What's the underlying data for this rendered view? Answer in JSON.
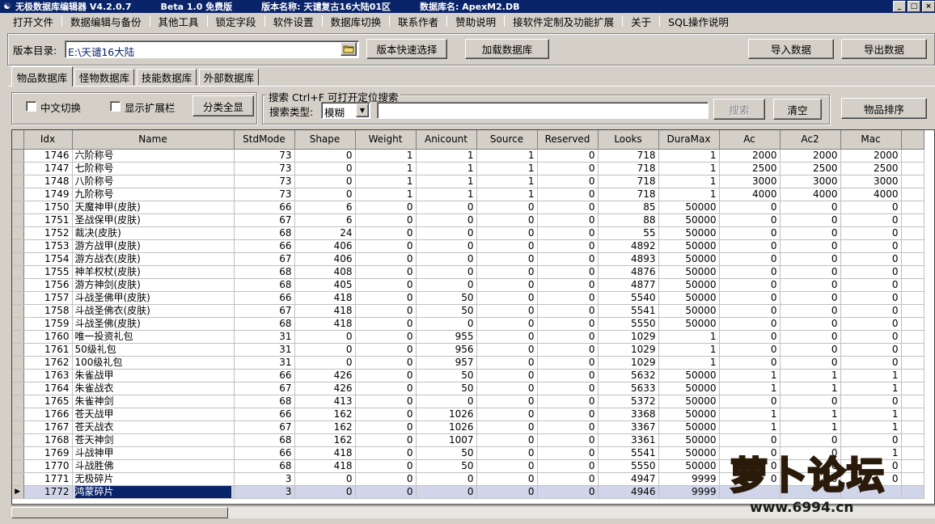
{
  "window": {
    "title_parts": [
      "无极数据库编辑器 V4.2.0.7",
      "Beta 1.0 免费版",
      "版本名称: 天谴复古16大陆01区",
      "数据库名: ApexM2.DB"
    ],
    "buttons": [
      "_",
      "□",
      "×"
    ]
  },
  "menu": {
    "items": [
      "打开文件",
      "数据编辑与备份",
      "其他工具",
      "锁定字段",
      "软件设置",
      "数据库切换",
      "联系作者",
      "赞助说明",
      "接软件定制及功能扩展",
      "关于",
      "SQL操作说明"
    ]
  },
  "toolbar": {
    "version_dir_label": "版本目录:",
    "version_dir_value": "E:\\天谴16大陆",
    "quick_select_label": "版本快速选择",
    "load_db_label": "加载数据库",
    "import_label": "导入数据",
    "export_label": "导出数据"
  },
  "tabs": [
    "物品数据库",
    "怪物数据库",
    "技能数据库",
    "外部数据库"
  ],
  "options": {
    "chinese_toggle_label": "中文切换",
    "show_ext_label": "显示扩展栏",
    "show_all_label": "分类全显"
  },
  "search": {
    "group_title": "搜索 Ctrl+F 可打开定位搜索",
    "type_label": "搜索类型:",
    "type_value": "模糊",
    "search_value": "",
    "search_button": "搜索",
    "clear_button": "清空",
    "sort_button": "物品排序"
  },
  "grid": {
    "columns": [
      "Idx",
      "Name",
      "StdMode",
      "Shape",
      "Weight",
      "Anicount",
      "Source",
      "Reserved",
      "Looks",
      "DuraMax",
      "Ac",
      "Ac2",
      "Mac"
    ],
    "selected_index": 26,
    "rows": [
      [
        "1746",
        "六阶称号",
        "73",
        "0",
        "1",
        "1",
        "1",
        "0",
        "718",
        "1",
        "2000",
        "2000",
        "2000"
      ],
      [
        "1747",
        "七阶称号",
        "73",
        "0",
        "1",
        "1",
        "1",
        "0",
        "718",
        "1",
        "2500",
        "2500",
        "2500"
      ],
      [
        "1748",
        "八阶称号",
        "73",
        "0",
        "1",
        "1",
        "1",
        "0",
        "718",
        "1",
        "3000",
        "3000",
        "3000"
      ],
      [
        "1749",
        "九阶称号",
        "73",
        "0",
        "1",
        "1",
        "1",
        "0",
        "718",
        "1",
        "4000",
        "4000",
        "4000"
      ],
      [
        "1750",
        "天魔神甲(皮肤)",
        "66",
        "6",
        "0",
        "0",
        "0",
        "0",
        "85",
        "50000",
        "0",
        "0",
        "0"
      ],
      [
        "1751",
        "圣战保甲(皮肤)",
        "67",
        "6",
        "0",
        "0",
        "0",
        "0",
        "88",
        "50000",
        "0",
        "0",
        "0"
      ],
      [
        "1752",
        "裁决(皮肤)",
        "68",
        "24",
        "0",
        "0",
        "0",
        "0",
        "55",
        "50000",
        "0",
        "0",
        "0"
      ],
      [
        "1753",
        "游方战甲(皮肤)",
        "66",
        "406",
        "0",
        "0",
        "0",
        "0",
        "4892",
        "50000",
        "0",
        "0",
        "0"
      ],
      [
        "1754",
        "游方战衣(皮肤)",
        "67",
        "406",
        "0",
        "0",
        "0",
        "0",
        "4893",
        "50000",
        "0",
        "0",
        "0"
      ],
      [
        "1755",
        "神羊权杖(皮肤)",
        "68",
        "408",
        "0",
        "0",
        "0",
        "0",
        "4876",
        "50000",
        "0",
        "0",
        "0"
      ],
      [
        "1756",
        "游方神剑(皮肤)",
        "68",
        "405",
        "0",
        "0",
        "0",
        "0",
        "4877",
        "50000",
        "0",
        "0",
        "0"
      ],
      [
        "1757",
        "斗战圣佛甲(皮肤)",
        "66",
        "418",
        "0",
        "50",
        "0",
        "0",
        "5540",
        "50000",
        "0",
        "0",
        "0"
      ],
      [
        "1758",
        "斗战圣佛衣(皮肤)",
        "67",
        "418",
        "0",
        "50",
        "0",
        "0",
        "5541",
        "50000",
        "0",
        "0",
        "0"
      ],
      [
        "1759",
        "斗战圣佛(皮肤)",
        "68",
        "418",
        "0",
        "0",
        "0",
        "0",
        "5550",
        "50000",
        "0",
        "0",
        "0"
      ],
      [
        "1760",
        "唯一投资礼包",
        "31",
        "0",
        "0",
        "955",
        "0",
        "0",
        "1029",
        "1",
        "0",
        "0",
        "0"
      ],
      [
        "1761",
        "50级礼包",
        "31",
        "0",
        "0",
        "956",
        "0",
        "0",
        "1029",
        "1",
        "0",
        "0",
        "0"
      ],
      [
        "1762",
        "100级礼包",
        "31",
        "0",
        "0",
        "957",
        "0",
        "0",
        "1029",
        "1",
        "0",
        "0",
        "0"
      ],
      [
        "1763",
        "朱雀战甲",
        "66",
        "426",
        "0",
        "50",
        "0",
        "0",
        "5632",
        "50000",
        "1",
        "1",
        "1"
      ],
      [
        "1764",
        "朱雀战衣",
        "67",
        "426",
        "0",
        "50",
        "0",
        "0",
        "5633",
        "50000",
        "1",
        "1",
        "1"
      ],
      [
        "1765",
        "朱雀神剑",
        "68",
        "413",
        "0",
        "0",
        "0",
        "0",
        "5372",
        "50000",
        "0",
        "0",
        "0"
      ],
      [
        "1766",
        "苍天战甲",
        "66",
        "162",
        "0",
        "1026",
        "0",
        "0",
        "3368",
        "50000",
        "1",
        "1",
        "1"
      ],
      [
        "1767",
        "苍天战衣",
        "67",
        "162",
        "0",
        "1026",
        "0",
        "0",
        "3367",
        "50000",
        "1",
        "1",
        "1"
      ],
      [
        "1768",
        "苍天神剑",
        "68",
        "162",
        "0",
        "1007",
        "0",
        "0",
        "3361",
        "50000",
        "0",
        "0",
        "0"
      ],
      [
        "1769",
        "斗战神甲",
        "66",
        "418",
        "0",
        "50",
        "0",
        "0",
        "5541",
        "50000",
        "0",
        "0",
        "1"
      ],
      [
        "1770",
        "斗战胜佛",
        "68",
        "418",
        "0",
        "50",
        "0",
        "0",
        "5550",
        "50000",
        "0",
        "0",
        "0"
      ],
      [
        "1771",
        "无极碎片",
        "3",
        "0",
        "0",
        "0",
        "0",
        "0",
        "4947",
        "9999",
        "0",
        "0",
        "0"
      ],
      [
        "1772",
        "鸿蒙碎片",
        "3",
        "0",
        "0",
        "0",
        "0",
        "0",
        "4946",
        "9999",
        "",
        "",
        ""
      ]
    ]
  },
  "watermark": {
    "text": "萝卜论坛",
    "url": "www.6994.cn"
  }
}
